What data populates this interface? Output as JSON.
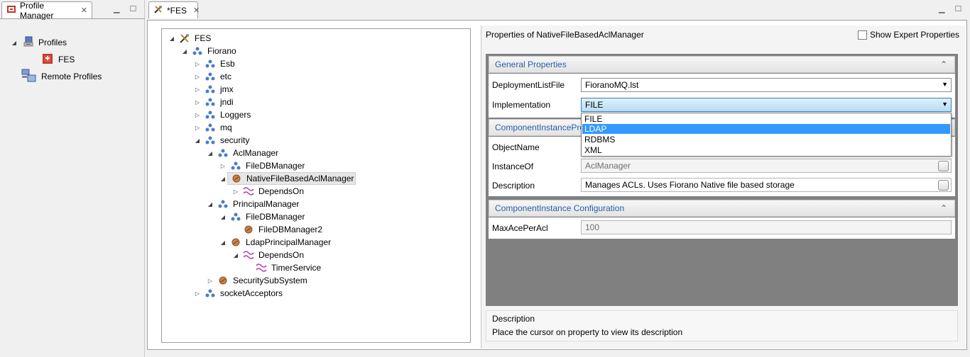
{
  "profile_manager": {
    "tab_label": "Profile Manager",
    "tree": [
      {
        "label": "Profiles",
        "icon": "profiles-icon"
      },
      {
        "label": "FES",
        "icon": "fes-profile-icon"
      },
      {
        "label": "Remote Profiles",
        "icon": "remote-profiles-icon"
      }
    ]
  },
  "editor": {
    "tab_label": "*FES",
    "tree": [
      {
        "label": "FES"
      },
      {
        "label": "Fiorano"
      },
      {
        "label": "Esb"
      },
      {
        "label": "etc"
      },
      {
        "label": "jmx"
      },
      {
        "label": "jndi"
      },
      {
        "label": "Loggers"
      },
      {
        "label": "mq"
      },
      {
        "label": "security"
      },
      {
        "label": "AclManager"
      },
      {
        "label": "FileDBManager"
      },
      {
        "label": "NativeFileBasedAclManager"
      },
      {
        "label": "DependsOn"
      },
      {
        "label": "PrincipalManager"
      },
      {
        "label": "FileDBManager"
      },
      {
        "label": "FileDBManager2"
      },
      {
        "label": "LdapPrincipalManager"
      },
      {
        "label": "DependsOn"
      },
      {
        "label": "TimerService"
      },
      {
        "label": "SecuritySubSystem"
      },
      {
        "label": "socketAcceptors"
      }
    ]
  },
  "properties": {
    "title": "Properties of NativeFileBasedAclManager",
    "show_expert_label": "Show Expert Properties",
    "general_section": "General Properties",
    "deployment_label": "DeploymentListFile",
    "deployment_value": "FioranoMQ.lst",
    "implementation_label": "Implementation",
    "implementation_value": "FILE",
    "implementation_options": [
      "FILE",
      "LDAP",
      "RDBMS",
      "XML"
    ],
    "component_props_section": "ComponentInstanceProperties",
    "objectname_label": "ObjectName",
    "instanceof_label": "InstanceOf",
    "instanceof_value": "AclManager",
    "description_label": "Description",
    "description_value": "Manages ACLs. Uses Fiorano Native file based storage",
    "config_section": "ComponentInstance Configuration",
    "maxace_label": "MaxAcePerAcl",
    "maxace_value": "100",
    "desc_title": "Description",
    "desc_text": "Place the cursor on property to view its description"
  },
  "colors": {
    "section_title": "#2b5ea8",
    "selection": "#3399ff",
    "prop_area_bg": "#808080"
  }
}
